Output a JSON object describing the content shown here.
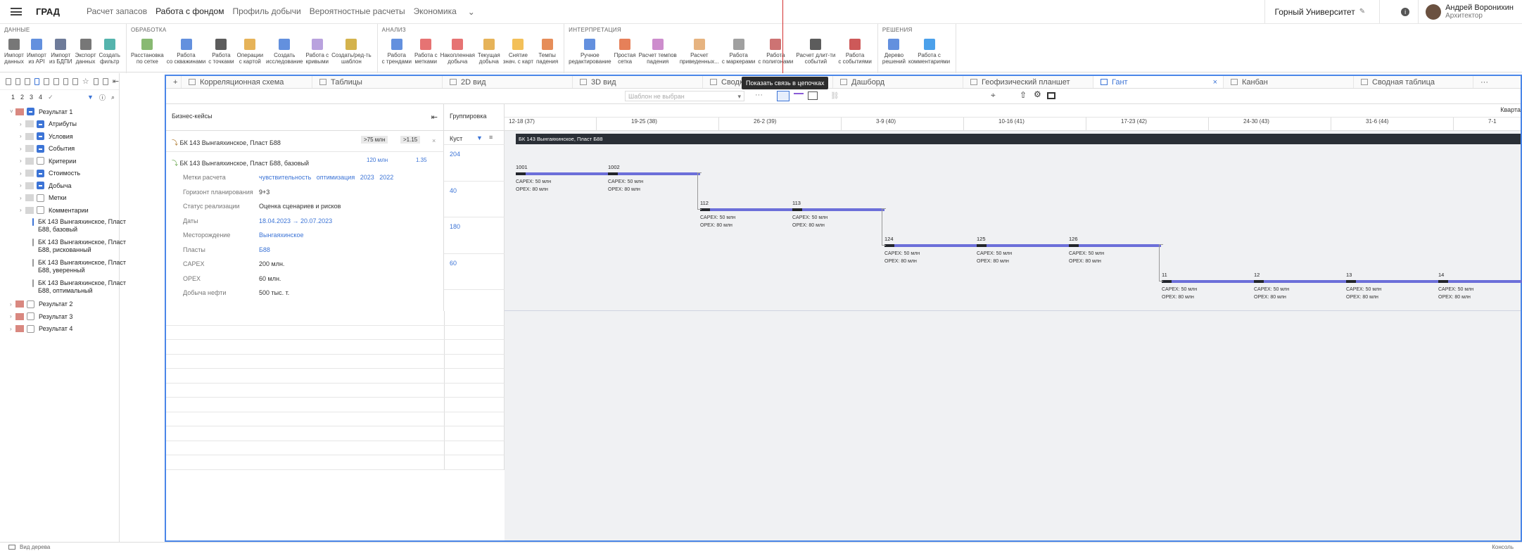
{
  "app": {
    "title": "ГРАД",
    "nav": [
      "Расчет запасов",
      "Работа с фондом",
      "Профиль добычи",
      "Вероятностные расчеты",
      "Экономика"
    ],
    "active_nav": "Работа с фондом",
    "org": "Горный Университет",
    "user_name": "Андрей Воронихин",
    "user_role": "Архитектор"
  },
  "ribbon": [
    {
      "title": "ДАННЫЕ",
      "tools": [
        "Импорт\nданных",
        "Импорт\nиз API",
        "Импорт\nиз БДПИ",
        "Экспорт\nданных",
        "Создать\nфильтр"
      ]
    },
    {
      "title": "ОБРАБОТКА",
      "tools": [
        "Расстановка\nпо сетке",
        "Работа\nсо скважинами",
        "Работа\nс точками",
        "Операции\nс картой",
        "Создать\nисследование",
        "Работа с\nкривыми",
        "Создать/ред-ть\nшаблон"
      ]
    },
    {
      "title": "АНАЛИЗ",
      "tools": [
        "Работа\nс трендами",
        "Работа с\nметками",
        "Накопленная\nдобыча",
        "Текущая\nдобыча",
        "Снятие\nзнач. с карт",
        "Темпы\nпадения"
      ]
    },
    {
      "title": "ИНТЕРПРЕТАЦИЯ",
      "tools": [
        "Ручное\nредактирование",
        "Простая\nсетка",
        "Расчет темпов\nпадения",
        "Расчет\nприведенных...",
        "Работа\nс маркерами",
        "Работа\nс полигонами",
        "Расчет длит-ти\nсобытий",
        "Работа\nс событиями"
      ]
    },
    {
      "title": "РЕШЕНИЯ",
      "tools": [
        "Дерево\nрешений",
        "Работа с\nкомментариями"
      ]
    }
  ],
  "left": {
    "levels": [
      "1",
      "2",
      "3",
      "4"
    ],
    "tree": [
      {
        "label": "Результат 1",
        "depth": 0,
        "arrow": "˅",
        "cb": "minus"
      },
      {
        "label": "Атрибуты",
        "depth": 1,
        "arrow": "›",
        "cb": "minus"
      },
      {
        "label": "Условия",
        "depth": 1,
        "arrow": "›",
        "cb": "minus"
      },
      {
        "label": "События",
        "depth": 1,
        "arrow": "›",
        "cb": "minus"
      },
      {
        "label": "Критерии",
        "depth": 1,
        "arrow": "›",
        "cb": ""
      },
      {
        "label": "Стоимость",
        "depth": 1,
        "arrow": "›",
        "cb": "minus"
      },
      {
        "label": "Добыча",
        "depth": 1,
        "arrow": "›",
        "cb": "minus"
      },
      {
        "label": "Метки",
        "depth": 1,
        "arrow": "›",
        "cb": ""
      },
      {
        "label": "Комментарии",
        "depth": 1,
        "arrow": "›",
        "cb": ""
      }
    ],
    "cases": [
      {
        "label": "БК 143 Вынгаяхинское, Пласт\nБ88, базовый",
        "cb": "checked"
      },
      {
        "label": "БК 143 Вынгаяхинское, Пласт\nБ88, рискованный",
        "cb": ""
      },
      {
        "label": "БК 143 Вынгаяхинское, Пласт\nБ88, уверенный",
        "cb": ""
      },
      {
        "label": "БК 143 Вынгаяхинское, Пласт\nБ88, оптимальный",
        "cb": ""
      }
    ],
    "results": [
      "Результат 2",
      "Результат 3",
      "Результат 4"
    ]
  },
  "tabs": [
    "Корреляционная схема",
    "Таблицы",
    "2D вид",
    "3D вид",
    "Сводка",
    "Дашборд",
    "Геофизический планшет",
    "Гант",
    "Канбан",
    "Сводная таблица"
  ],
  "active_tab": "Гант",
  "template_placeholder": "Шаблон не выбран",
  "tooltip": "Показать связь в цепочках",
  "table": {
    "bc_header": "Бизнес-кейсы",
    "group_header": "Группировка",
    "group_col": "Куст",
    "bc1": "БК 143 Вынгаяхинское, Пласт Б88",
    "bc1_badge1": ">75 млн",
    "bc1_badge2": ">1.15",
    "bc2": "БК 143 Вынгаяхинское, Пласт Б88, базовый",
    "bc2_badge1": "120 млн",
    "bc2_badge2": "1.35",
    "details": [
      {
        "k": "Метки расчета",
        "v": "чувствительность   оптимизация   2023   2022",
        "link": true
      },
      {
        "k": "Горизонт планирования",
        "v": "9+3",
        "link": false
      },
      {
        "k": "Статус реализации",
        "v": "Оценка сценариев и рисков",
        "link": false
      },
      {
        "k": "Даты",
        "v": "18.04.2023 → 20.07.2023",
        "link": true
      },
      {
        "k": "Месторождение",
        "v": "Вынгаяхинское",
        "link": true
      },
      {
        "k": "Пласты",
        "v": "Б88",
        "link": true
      },
      {
        "k": "CAPEX",
        "v": "200 млн.",
        "link": false
      },
      {
        "k": "OPEX",
        "v": "60 млн.",
        "link": false
      },
      {
        "k": "Добыча нефти",
        "v": "500 тыс. т.",
        "link": false
      }
    ],
    "groups": [
      "204",
      "40",
      "180",
      "60"
    ]
  },
  "gantt": {
    "quarter": "Кварта",
    "weeks": [
      "12-18 (37)",
      "19-25 (38)",
      "26-2 (39)",
      "3-9 (40)",
      "10-16 (41)",
      "17-23 (42)",
      "24-30 (43)",
      "31-6 (44)",
      "7-1"
    ],
    "banner": "БК 143 Вынгаяхинское, Пласт Б88",
    "tasks": [
      {
        "id": "1001",
        "capex": "CAPEX:  50 млн",
        "opex": "OPEX:  80 млн"
      },
      {
        "id": "1002",
        "capex": "CAPEX:  50 млн",
        "opex": "OPEX:  80 млн"
      },
      {
        "id": "112",
        "capex": "CAPEX:  50 млн",
        "opex": "OPEX:  80 млн"
      },
      {
        "id": "113",
        "capex": "CAPEX:  50 млн",
        "opex": "OPEX:  80 млн"
      },
      {
        "id": "124",
        "capex": "CAPEX:  50 млн",
        "opex": "OPEX:  80 млн"
      },
      {
        "id": "125",
        "capex": "CAPEX:  50 млн",
        "opex": "OPEX:  80 млн"
      },
      {
        "id": "126",
        "capex": "CAPEX:  50 млн",
        "opex": "OPEX:  80 млн"
      },
      {
        "id": "11",
        "capex": "CAPEX:  50 млн",
        "opex": "OPEX:  80 млн"
      },
      {
        "id": "12",
        "capex": "CAPEX:  50 млн",
        "opex": "OPEX:  80 млн"
      },
      {
        "id": "13",
        "capex": "CAPEX:  50 млн",
        "opex": "OPEX:  80 млн"
      },
      {
        "id": "14",
        "capex": "CAPEX:  50 млн",
        "opex": "OPEX:  80 млн"
      }
    ]
  },
  "status": {
    "left": "Вид дерева",
    "right": "Консоль"
  }
}
